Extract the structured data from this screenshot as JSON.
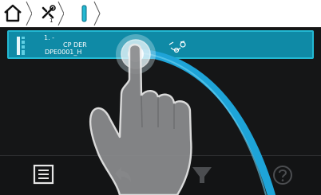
{
  "breadcrumb": {
    "home_icon": "home-icon",
    "items": [
      {
        "icon": "wrench-cross-icon",
        "number": "1"
      },
      {
        "icon": "vertical-bar-icon"
      }
    ]
  },
  "list": {
    "items": [
      {
        "index": "1. -",
        "title": "CP DER",
        "subtitle": "DPE0001_H",
        "handle_icon": "drag-handle-icon",
        "status_icon": "link-icon",
        "selected": true
      }
    ]
  },
  "toolbar": {
    "items": [
      {
        "icon": "menu-list-icon"
      },
      {
        "icon": "back-arrow-icon"
      },
      {
        "icon": "filter-icon"
      },
      {
        "icon": "help-icon"
      }
    ]
  },
  "gesture": {
    "icon": "tap-swipe-hand-icon"
  },
  "colors": {
    "accent": "#23b8d2",
    "row_background": "#0f8aa6",
    "background": "#151617"
  }
}
